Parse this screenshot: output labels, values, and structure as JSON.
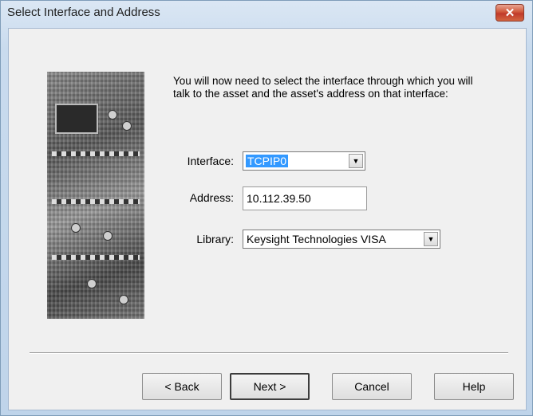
{
  "window": {
    "title": "Select Interface and Address",
    "close_glyph": "✕"
  },
  "intro_text": "You will now need to select the interface through which you will talk to the asset and the asset's address on that interface:",
  "fields": {
    "interface": {
      "label": "Interface:",
      "value": "TCPIP0"
    },
    "address": {
      "label": "Address:",
      "value": "10.112.39.50"
    },
    "library": {
      "label": "Library:",
      "value": "Keysight Technologies VISA"
    }
  },
  "icons": {
    "dropdown_arrow": "▼"
  },
  "buttons": {
    "back": "< Back",
    "next": "Next >",
    "cancel": "Cancel",
    "help": "Help"
  },
  "colors": {
    "selection": "#3399ff",
    "close_button": "#c0392b"
  }
}
